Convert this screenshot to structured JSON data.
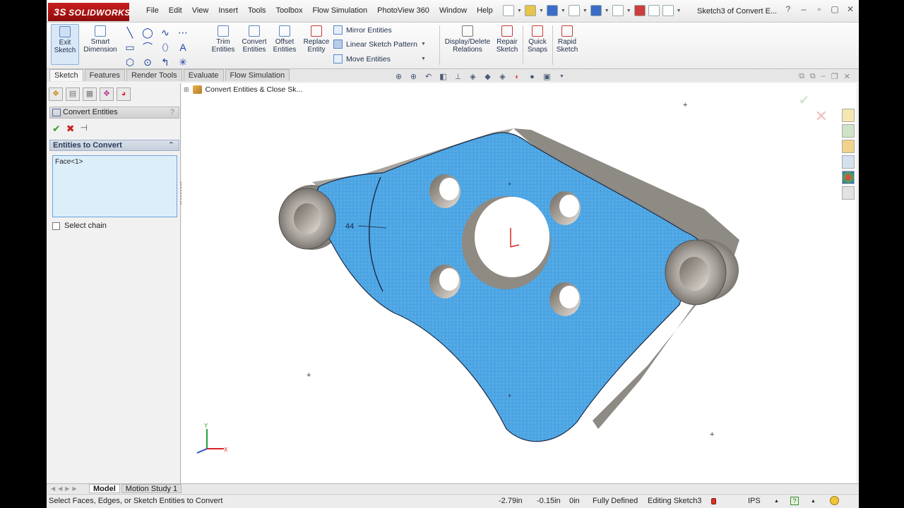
{
  "app": {
    "logo_text": "SOLIDWORKS",
    "document_title": "Sketch3 of Convert E...",
    "menu": [
      "File",
      "Edit",
      "View",
      "Insert",
      "Tools",
      "Toolbox",
      "Flow Simulation",
      "PhotoView 360",
      "Window",
      "Help"
    ]
  },
  "ribbon": {
    "exit_sketch": "Exit Sketch",
    "smart_dimension": "Smart Dimension",
    "trim_entities": "Trim Entities",
    "convert_entities": "Convert Entities",
    "offset_entities": "Offset Entities",
    "replace_entity": "Replace Entity",
    "mirror_entities": "Mirror Entities",
    "linear_sketch_pattern": "Linear Sketch Pattern",
    "move_entities": "Move Entities",
    "display_delete_relations": "Display/Delete Relations",
    "repair_sketch": "Repair Sketch",
    "quick_snaps": "Quick Snaps",
    "rapid_sketch": "Rapid Sketch"
  },
  "cm_tabs": [
    "Sketch",
    "Features",
    "Render Tools",
    "Evaluate",
    "Flow Simulation"
  ],
  "property_manager": {
    "title": "Convert Entities",
    "group_title": "Entities to Convert",
    "selection": "Face<1>",
    "select_chain_label": "Select chain",
    "select_chain_checked": false
  },
  "graphics": {
    "breadcrumb": "Convert Entities & Close Sk...",
    "dimension_text": "44",
    "face_color": "#4fa9e8",
    "edge_color": "#1c2a44",
    "wall_color": "#8e8a84",
    "triad_labels": {
      "y": "Y",
      "x": "X"
    }
  },
  "model_tabs": [
    "Model",
    "Motion Study 1"
  ],
  "statusbar": {
    "message": "Select Faces, Edges, or Sketch Entities to Convert",
    "x": "-2.79in",
    "y": "-0.15in",
    "z": "0in",
    "state": "Fully Defined",
    "editing": "Editing Sketch3",
    "units": "IPS",
    "help": "?"
  }
}
